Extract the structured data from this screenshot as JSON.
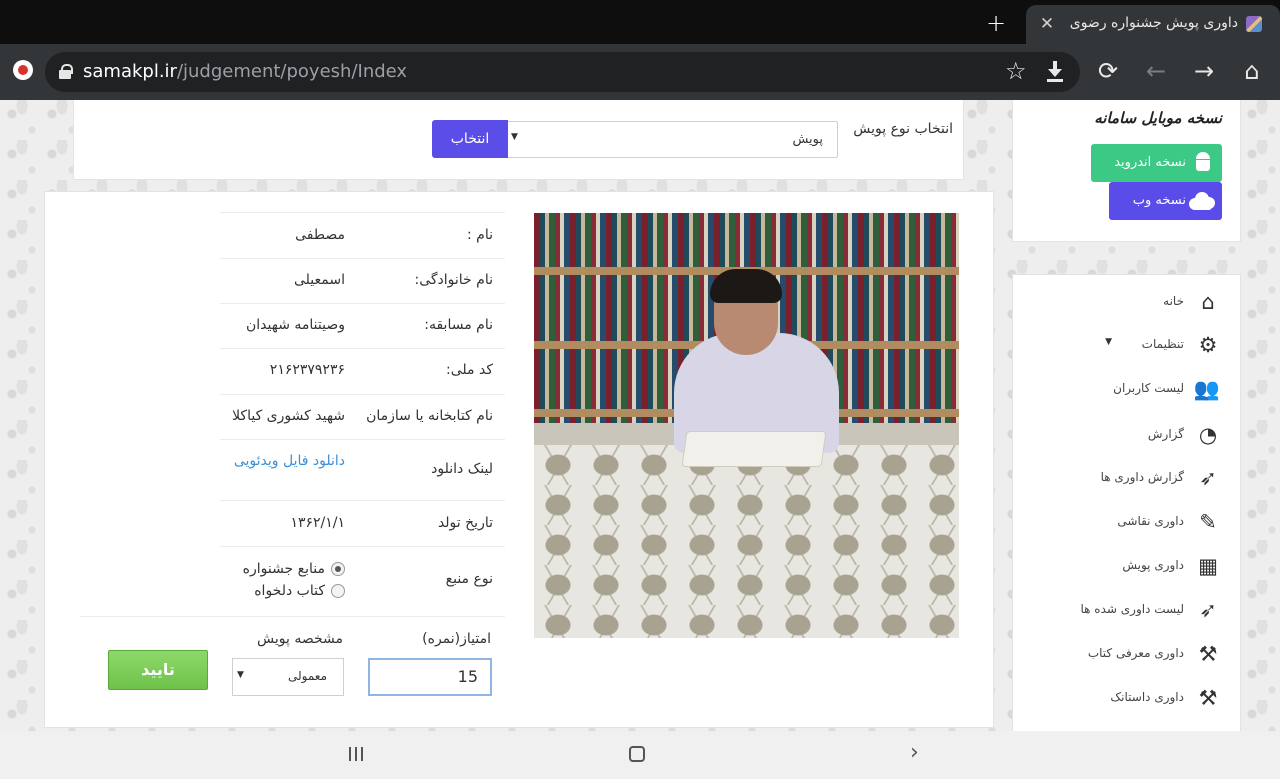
{
  "browser": {
    "tab_title": "داوری پویش جشنواره رضوی",
    "close_glyph": "✕",
    "new_tab_glyph": "+",
    "url_host": "samakpl.ir",
    "url_path": "/judgement/poyesh/Index"
  },
  "mobile": {
    "title": "نسخه موبایل سامانه",
    "android_label": "نسخه اندروید",
    "web_label": "نسخه وب"
  },
  "menu": {
    "items": [
      {
        "label": "خانه",
        "icon": "home-icon"
      },
      {
        "label": "تنظیمات",
        "icon": "gear-icon"
      },
      {
        "label": "لیست کاربران",
        "icon": "users-icon"
      },
      {
        "label": "گزارش",
        "icon": "dashboard-icon"
      },
      {
        "label": "گزارش داوری ها",
        "icon": "rocket-icon"
      },
      {
        "label": "داوری نقاشی",
        "icon": "paintbrush-icon"
      },
      {
        "label": "داوری پویش",
        "icon": "film-icon"
      },
      {
        "label": "لیست داوری شده ها",
        "icon": "rocket-icon"
      },
      {
        "label": "داوری معرفی کتاب",
        "icon": "gavel-icon"
      },
      {
        "label": "داوری داستانک",
        "icon": "gavel-icon"
      }
    ]
  },
  "selector": {
    "label": "انتخاب نوع پویش",
    "value": "پویش",
    "button": "انتخاب"
  },
  "info": {
    "first_name_label": "نام :",
    "first_name": "مصطفی",
    "last_name_label": "نام خانوادگی:",
    "last_name": "اسمعیلی",
    "contest_label": "نام مسابقه:",
    "contest": "وصیتنامه شهیدان",
    "national_id_label": "کد ملی:",
    "national_id": "۲۱۶۲۳۷۹۲۳۶",
    "library_label": "نام کتابخانه یا سازمان",
    "library": "شهید کشوری کیاکلا",
    "download_label": "لینک دانلود",
    "download_link": "دانلود فایل ویدئویی",
    "birth_label": "تاریخ تولد",
    "birth": "۱۳۶۲/۱/۱",
    "source_label": "نوع منبع",
    "source_options": [
      "منابع جشنواره",
      "کتاب دلخواه"
    ]
  },
  "grading": {
    "score_label": "امتیاز(نمره)",
    "score_value": "15",
    "spec_label": "مشخصه پویش",
    "spec_value": "معمولی",
    "confirm": "تایید"
  }
}
